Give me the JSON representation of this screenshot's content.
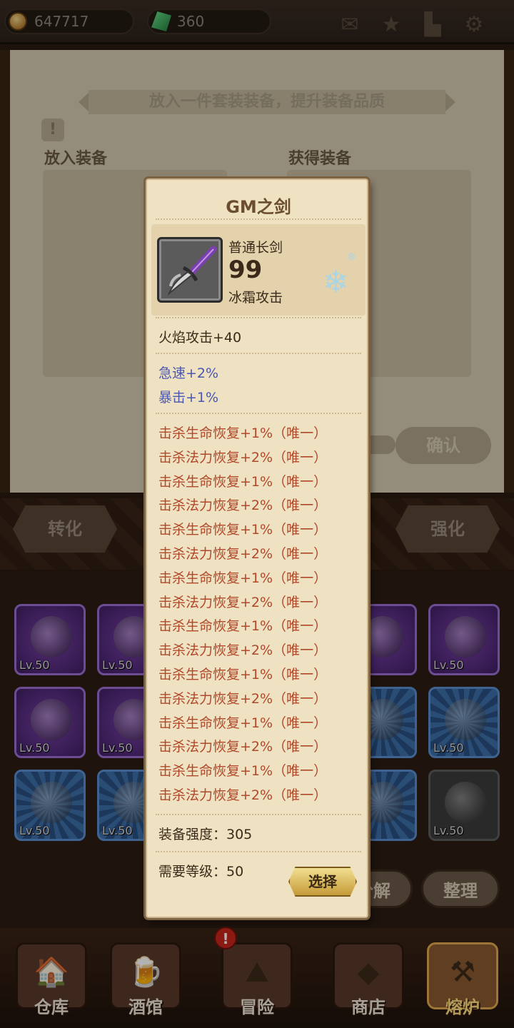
{
  "currency": {
    "gold": "647717",
    "gems": "360"
  },
  "top_icons": [
    "mail-icon",
    "favorite-icon",
    "bookmark-icon",
    "settings-icon"
  ],
  "forge": {
    "hint": "放入一件套装装备，提升装备品质",
    "input_label": "放入装备",
    "output_label": "获得装备",
    "confirm": "确认"
  },
  "tabs": {
    "convert": "转化",
    "enhance": "强化"
  },
  "inventory": {
    "slots": [
      {
        "rarity": "purple",
        "level": "Lv.50"
      },
      {
        "rarity": "purple",
        "level": "Lv.50"
      },
      {
        "rarity": "purple",
        "level": "50"
      },
      {
        "rarity": "purple",
        "level": "Lv.50"
      },
      {
        "rarity": "purple",
        "level": "Lv.50"
      },
      {
        "rarity": "purple",
        "level": "Lv.50"
      },
      {
        "rarity": "blue",
        "level": "50"
      },
      {
        "rarity": "blue",
        "level": "Lv.50"
      },
      {
        "rarity": "blue",
        "level": "Lv.50"
      },
      {
        "rarity": "blue",
        "level": "Lv.50"
      },
      {
        "rarity": "blue",
        "level": "50"
      },
      {
        "rarity": "gray",
        "level": "Lv.50"
      }
    ],
    "decompose": "分解",
    "sort": "整理"
  },
  "nav": {
    "warehouse": "仓库",
    "tavern": "酒馆",
    "adventure": "冒险",
    "shop": "商店",
    "furnace": "熔炉",
    "alert": "!"
  },
  "tooltip": {
    "title": "GM之剑",
    "item_type": "普通长剑",
    "power": "99",
    "element": "冰霜攻击",
    "main_stat": "火焰攻击+40",
    "blue_stats": [
      "急速+2%",
      "暴击+1%"
    ],
    "unique_stats": [
      "击杀生命恢复+1%（唯一）",
      "击杀法力恢复+2%（唯一）",
      "击杀生命恢复+1%（唯一）",
      "击杀法力恢复+2%（唯一）",
      "击杀生命恢复+1%（唯一）",
      "击杀法力恢复+2%（唯一）",
      "击杀生命恢复+1%（唯一）",
      "击杀法力恢复+2%（唯一）",
      "击杀生命恢复+1%（唯一）",
      "击杀法力恢复+2%（唯一）",
      "击杀生命恢复+1%（唯一）",
      "击杀法力恢复+2%（唯一）",
      "击杀生命恢复+1%（唯一）",
      "击杀法力恢复+2%（唯一）",
      "击杀生命恢复+1%（唯一）",
      "击杀法力恢复+2%（唯一）"
    ],
    "strength": "装备强度：305",
    "required_level": "需要等级：50",
    "select": "选择"
  }
}
